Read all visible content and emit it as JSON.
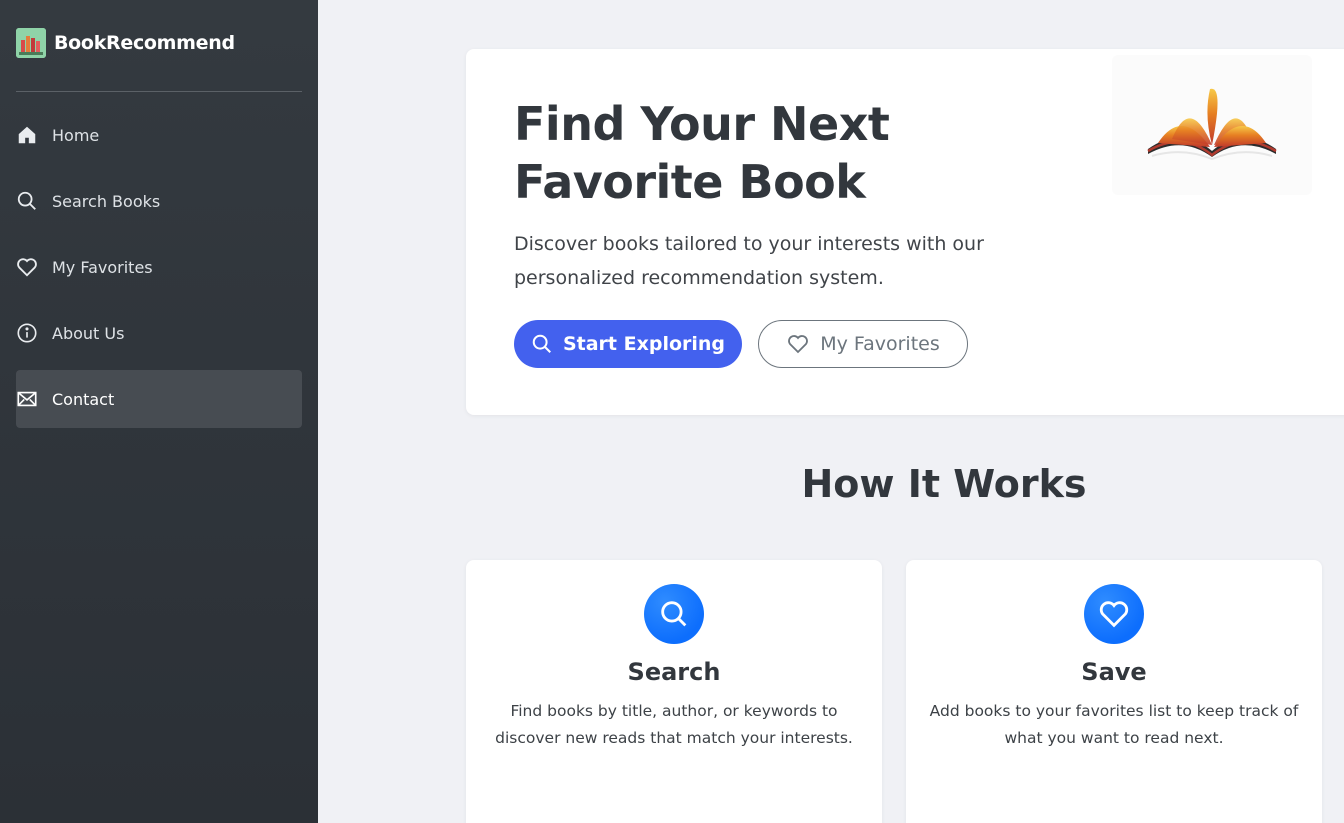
{
  "brand": {
    "name": "BookRecommend"
  },
  "sidebar": {
    "items": [
      {
        "label": "Home",
        "icon": "home-icon"
      },
      {
        "label": "Search Books",
        "icon": "search-icon"
      },
      {
        "label": "My Favorites",
        "icon": "heart-icon"
      },
      {
        "label": "About Us",
        "icon": "info-icon"
      },
      {
        "label": "Contact",
        "icon": "envelope-icon",
        "active": true
      }
    ]
  },
  "hero": {
    "title": "Find Your Next Favorite Book",
    "description": "Discover books tailored to your interests with our personalized recommendation system.",
    "primary_button": "Start Exploring",
    "secondary_button": "My Favorites"
  },
  "how_it_works": {
    "title": "How It Works",
    "cards": [
      {
        "title": "Search",
        "icon": "search-icon",
        "description": "Find books by title, author, or keywords to discover new reads that match your interests."
      },
      {
        "title": "Save",
        "icon": "heart-icon",
        "description": "Add books to your favorites list to keep track of what you want to read next."
      }
    ]
  },
  "colors": {
    "sidebar_bg": "#343a40",
    "accent": "#4361ee",
    "card_icon": "#0d6efd",
    "page_bg": "#f0f1f5"
  }
}
